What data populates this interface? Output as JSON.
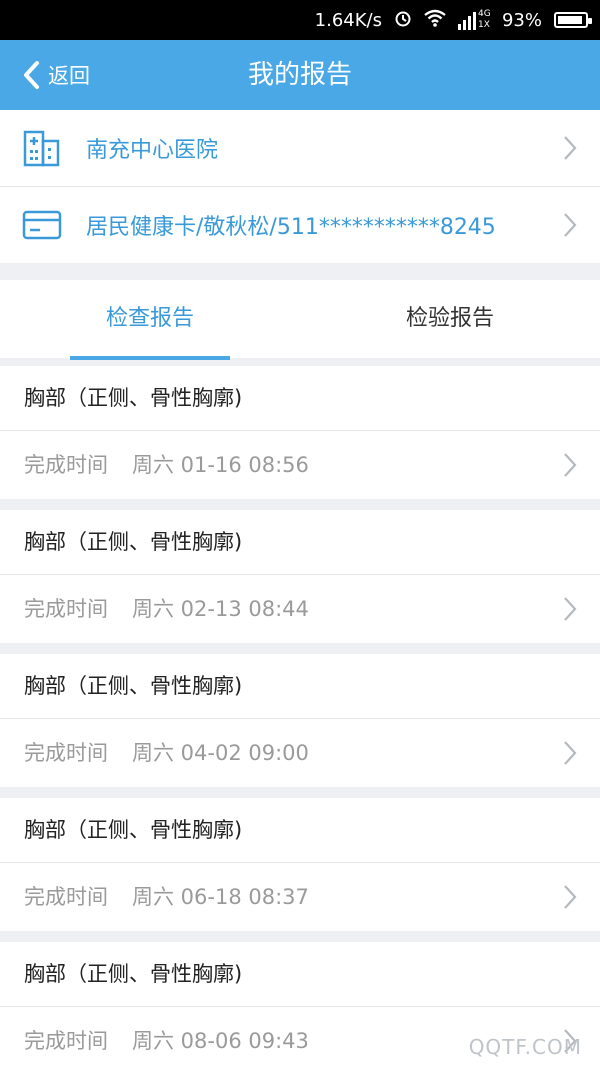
{
  "status_bar": {
    "net_speed": "1.64K/s",
    "signal_label_top": "4G",
    "signal_label_bottom": "1X",
    "battery": "93%",
    "battery_level": 0.93
  },
  "header": {
    "back_label": "返回",
    "title": "我的报告"
  },
  "info": {
    "hospital": "南充中心医院",
    "card": "居民健康卡/敬秋松/511***********8245"
  },
  "tabs": [
    {
      "label": "检查报告",
      "active": true
    },
    {
      "label": "检验报告",
      "active": false
    }
  ],
  "reports": [
    {
      "name": "胸部（正侧、骨性胸廓)",
      "time_label": "完成时间",
      "time": "周六 01-16 08:56"
    },
    {
      "name": "胸部（正侧、骨性胸廓)",
      "time_label": "完成时间",
      "time": "周六 02-13 08:44"
    },
    {
      "name": "胸部（正侧、骨性胸廓)",
      "time_label": "完成时间",
      "time": "周六 04-02 09:00"
    },
    {
      "name": "胸部（正侧、骨性胸廓)",
      "time_label": "完成时间",
      "time": "周六 06-18 08:37"
    },
    {
      "name": "胸部（正侧、骨性胸廓)",
      "time_label": "完成时间",
      "time": "周六 08-06 09:43"
    }
  ],
  "watermark": "QQTF.COM",
  "colors": {
    "accent": "#4aa8e6",
    "link": "#3a9ad9"
  }
}
